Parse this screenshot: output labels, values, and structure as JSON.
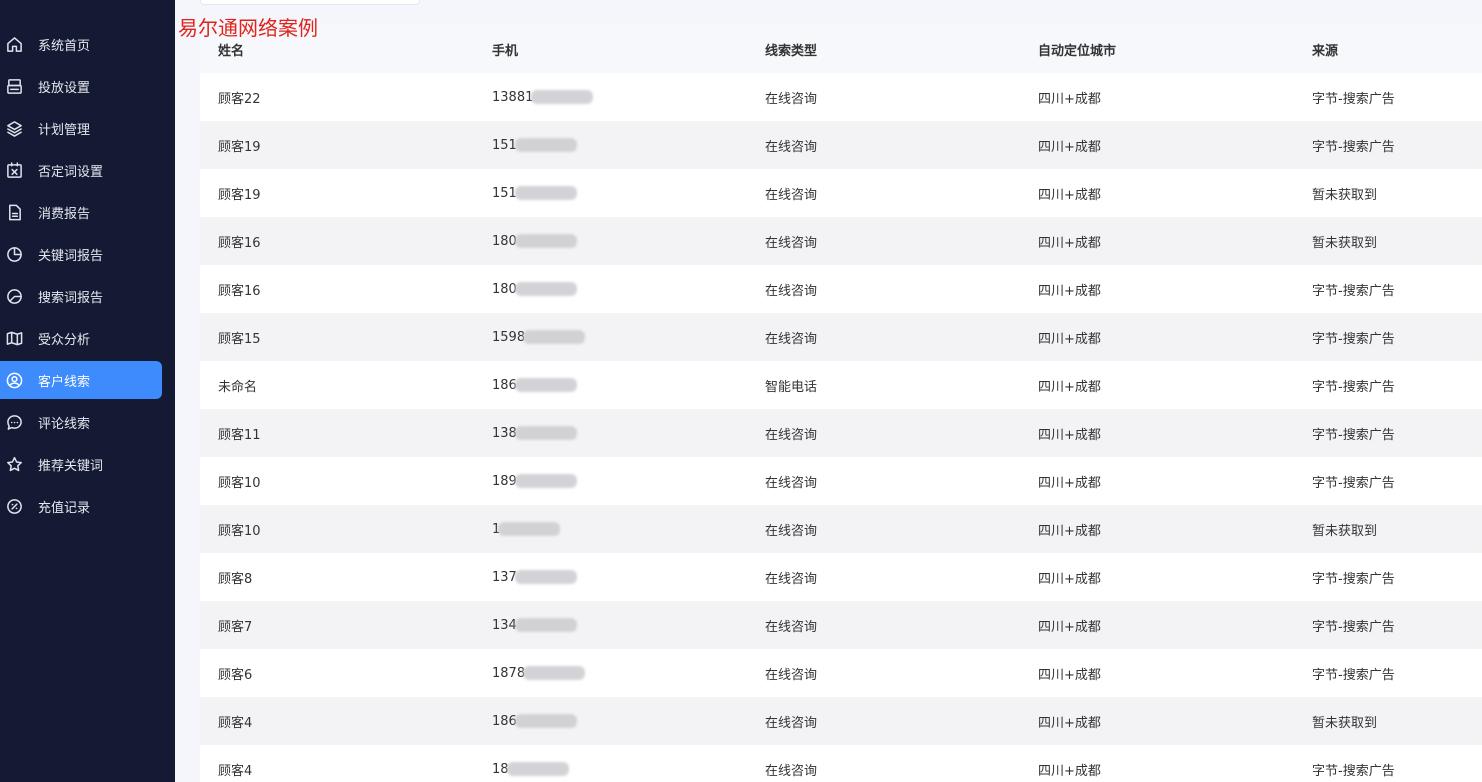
{
  "watermark": "易尔通网络案例",
  "sidebar": {
    "items": [
      {
        "label": "系统首页",
        "icon": "home-icon",
        "active": false
      },
      {
        "label": "投放设置",
        "icon": "printer-icon",
        "active": false
      },
      {
        "label": "计划管理",
        "icon": "layers-icon",
        "active": false
      },
      {
        "label": "否定词设置",
        "icon": "calendar-x-icon",
        "active": false
      },
      {
        "label": "消费报告",
        "icon": "document-icon",
        "active": false
      },
      {
        "label": "关键词报告",
        "icon": "pie-chart-icon",
        "active": false
      },
      {
        "label": "搜索词报告",
        "icon": "pie-chart-alt-icon",
        "active": false
      },
      {
        "label": "受众分析",
        "icon": "map-icon",
        "active": false
      },
      {
        "label": "客户线索",
        "icon": "user-circle-icon",
        "active": true
      },
      {
        "label": "评论线索",
        "icon": "comment-icon",
        "active": false
      },
      {
        "label": "推荐关键词",
        "icon": "star-icon",
        "active": false
      },
      {
        "label": "充值记录",
        "icon": "coin-icon",
        "active": false
      }
    ]
  },
  "table": {
    "headers": [
      "姓名",
      "手机",
      "线索类型",
      "自动定位城市",
      "来源"
    ],
    "rows": [
      {
        "name": "顾客22",
        "phone": "13881",
        "type": "在线咨询",
        "city": "四川+成都",
        "source": "字节-搜索广告"
      },
      {
        "name": "顾客19",
        "phone": "151",
        "type": "在线咨询",
        "city": "四川+成都",
        "source": "字节-搜索广告"
      },
      {
        "name": "顾客19",
        "phone": "151",
        "type": "在线咨询",
        "city": "四川+成都",
        "source": "暂未获取到"
      },
      {
        "name": "顾客16",
        "phone": "180",
        "type": "在线咨询",
        "city": "四川+成都",
        "source": "暂未获取到"
      },
      {
        "name": "顾客16",
        "phone": "180",
        "type": "在线咨询",
        "city": "四川+成都",
        "source": "字节-搜索广告"
      },
      {
        "name": "顾客15",
        "phone": "1598",
        "type": "在线咨询",
        "city": "四川+成都",
        "source": "字节-搜索广告"
      },
      {
        "name": "未命名",
        "phone": "186",
        "type": "智能电话",
        "city": "四川+成都",
        "source": "字节-搜索广告"
      },
      {
        "name": "顾客11",
        "phone": "138",
        "type": "在线咨询",
        "city": "四川+成都",
        "source": "字节-搜索广告"
      },
      {
        "name": "顾客10",
        "phone": "189",
        "type": "在线咨询",
        "city": "四川+成都",
        "source": "字节-搜索广告"
      },
      {
        "name": "顾客10",
        "phone": "1",
        "type": "在线咨询",
        "city": "四川+成都",
        "source": "暂未获取到"
      },
      {
        "name": "顾客8",
        "phone": "137",
        "type": "在线咨询",
        "city": "四川+成都",
        "source": "字节-搜索广告"
      },
      {
        "name": "顾客7",
        "phone": "134",
        "type": "在线咨询",
        "city": "四川+成都",
        "source": "字节-搜索广告"
      },
      {
        "name": "顾客6",
        "phone": "1878",
        "type": "在线咨询",
        "city": "四川+成都",
        "source": "字节-搜索广告"
      },
      {
        "name": "顾客4",
        "phone": "186",
        "type": "在线咨询",
        "city": "四川+成都",
        "source": "暂未获取到"
      },
      {
        "name": "顾客4",
        "phone": "18",
        "type": "在线咨询",
        "city": "四川+成都",
        "source": "字节-搜索广告"
      }
    ]
  },
  "colors": {
    "sidebar_bg": "#141a33",
    "active": "#3d8bfd",
    "watermark": "#e0241b"
  }
}
